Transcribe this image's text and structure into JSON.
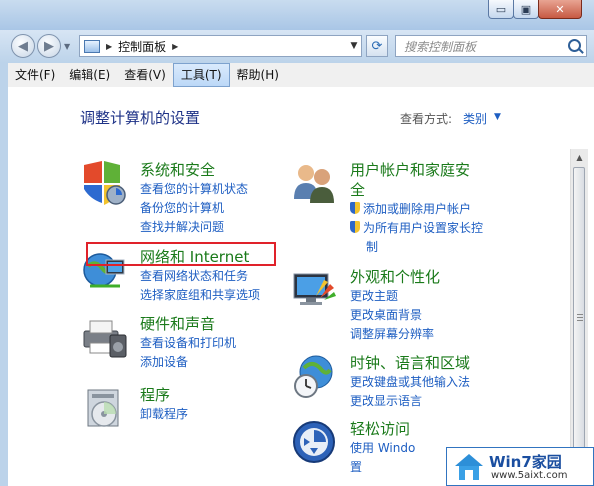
{
  "window_controls": {
    "minimize": "▭",
    "maximize": "▣",
    "close": "✕"
  },
  "nav": {
    "breadcrumb": "控制面板",
    "search_placeholder": "搜索控制面板"
  },
  "menubar": [
    {
      "label": "文件(F)"
    },
    {
      "label": "编辑(E)"
    },
    {
      "label": "查看(V)"
    },
    {
      "label": "工具(T)"
    },
    {
      "label": "帮助(H)"
    }
  ],
  "page": {
    "heading": "调整计算机的设置",
    "view_label": "查看方式:",
    "view_value": "类别"
  },
  "categories": {
    "system": {
      "title": "系统和安全",
      "links": [
        "查看您的计算机状态",
        "备份您的计算机",
        "查找并解决问题"
      ]
    },
    "network": {
      "title": "网络和 Internet",
      "links": [
        "查看网络状态和任务",
        "选择家庭组和共享选项"
      ]
    },
    "hardware": {
      "title": "硬件和声音",
      "links": [
        "查看设备和打印机",
        "添加设备"
      ]
    },
    "programs": {
      "title": "程序",
      "links": [
        "卸载程序"
      ]
    },
    "users": {
      "title1": "用户帐户和家庭安",
      "title2": "全",
      "links": [
        "添加或删除用户帐户",
        "为所有用户设置家长控",
        "制"
      ]
    },
    "appearance": {
      "title": "外观和个性化",
      "links": [
        "更改主题",
        "更改桌面背景",
        "调整屏幕分辨率"
      ]
    },
    "clock": {
      "title": "时钟、语言和区域",
      "links": [
        "更改键盘或其他输入法",
        "更改显示语言"
      ]
    },
    "ease": {
      "title": "轻松访问",
      "links": [
        "使用 Windo",
        "置"
      ]
    }
  },
  "watermark": {
    "brand": "Win7家园",
    "url": "www.5aixt.com"
  },
  "colors": {
    "link": "#1e5ec2",
    "category_title": "#1a7a1a",
    "heading": "#1e3287",
    "highlight": "#e0222a"
  }
}
